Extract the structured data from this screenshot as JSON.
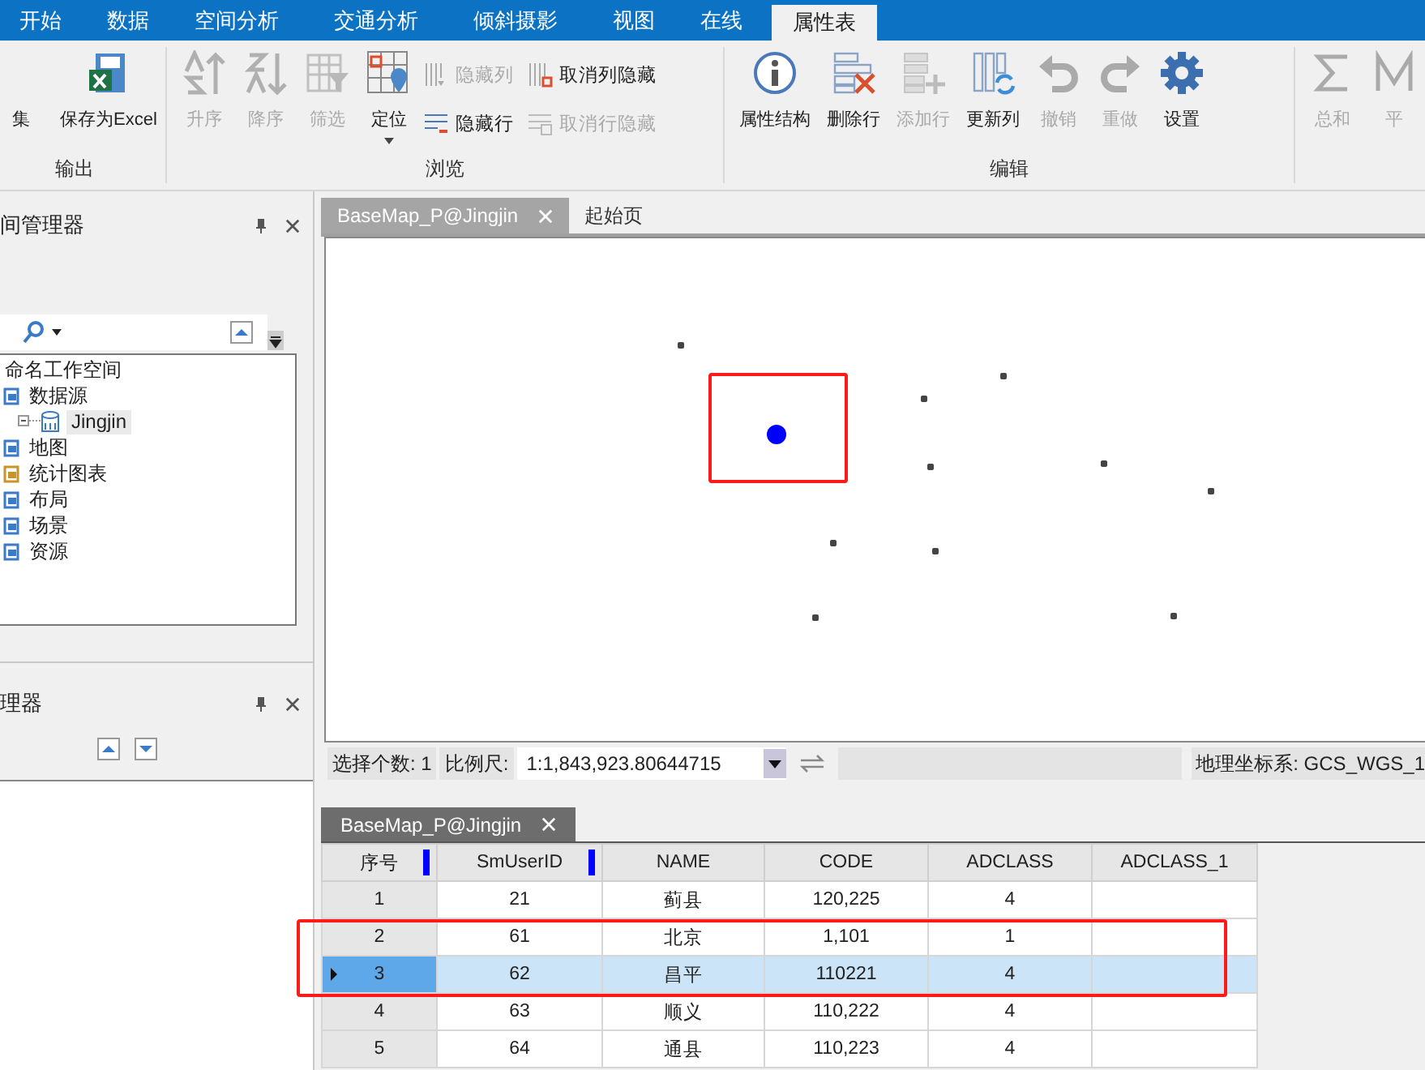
{
  "ribbon_tabs": [
    {
      "label": "开始",
      "selected": false
    },
    {
      "label": "数据",
      "selected": false
    },
    {
      "label": "空间分析",
      "selected": false
    },
    {
      "label": "交通分析",
      "selected": false
    },
    {
      "label": "倾斜摄影",
      "selected": false
    },
    {
      "label": "视图",
      "selected": false
    },
    {
      "label": "在线",
      "selected": false
    },
    {
      "label": "属性表",
      "selected": true
    }
  ],
  "ribbon_groups": [
    {
      "label": "输出",
      "buttons": [
        {
          "label": "集",
          "kind": "none",
          "disabled": false,
          "dropdown": false
        },
        {
          "label": "保存为Excel",
          "kind": "excel",
          "disabled": false,
          "dropdown": false
        }
      ]
    },
    {
      "label": "浏览",
      "buttons": [
        {
          "label": "升序",
          "kind": "sort-asc",
          "disabled": true,
          "dropdown": false
        },
        {
          "label": "降序",
          "kind": "sort-desc",
          "disabled": true,
          "dropdown": false
        },
        {
          "label": "筛选",
          "kind": "filter",
          "disabled": true,
          "dropdown": false
        },
        {
          "label": "定位",
          "kind": "locate",
          "disabled": false,
          "dropdown": true
        }
      ],
      "small_buttons": [
        {
          "label": "隐藏列",
          "kind": "hide-col",
          "disabled": true
        },
        {
          "label": "隐藏行",
          "kind": "hide-row",
          "disabled": false
        },
        {
          "label": "取消列隐藏",
          "kind": "show-col",
          "disabled": false
        },
        {
          "label": "取消行隐藏",
          "kind": "show-row",
          "disabled": true
        }
      ]
    },
    {
      "label": "编辑",
      "buttons": [
        {
          "label": "属性结构",
          "kind": "info",
          "disabled": false,
          "dropdown": false
        },
        {
          "label": "删除行",
          "kind": "delete-row",
          "disabled": false,
          "dropdown": false
        },
        {
          "label": "添加行",
          "kind": "add-row",
          "disabled": true,
          "dropdown": false
        },
        {
          "label": "更新列",
          "kind": "refresh-col",
          "disabled": false,
          "dropdown": false
        },
        {
          "label": "撤销",
          "kind": "undo",
          "disabled": true,
          "dropdown": false
        },
        {
          "label": "重做",
          "kind": "redo",
          "disabled": true,
          "dropdown": false
        },
        {
          "label": "设置",
          "kind": "gear",
          "disabled": false,
          "dropdown": false
        }
      ]
    },
    {
      "buttons": [
        {
          "label": "总和",
          "kind": "sum",
          "disabled": true,
          "dropdown": false
        },
        {
          "label": "平",
          "kind": "mean",
          "disabled": true,
          "dropdown": false
        }
      ]
    }
  ],
  "workspace_panel": {
    "title": "间管理器",
    "tree": [
      {
        "label": "命名工作空间",
        "selected": false,
        "children": [
          {
            "label": "数据源",
            "kind": "datasources",
            "selected": false,
            "children": [
              {
                "label": "Jingjin",
                "kind": "datasource",
                "selected": true
              }
            ]
          },
          {
            "label": "地图",
            "kind": "map",
            "selected": false
          },
          {
            "label": "统计图表",
            "kind": "chart",
            "selected": false
          },
          {
            "label": "布局",
            "kind": "layout",
            "selected": false
          },
          {
            "label": "场景",
            "kind": "scene",
            "selected": false
          },
          {
            "label": "资源",
            "kind": "resource",
            "selected": false
          }
        ]
      }
    ]
  },
  "layer_panel": {
    "title": "理器"
  },
  "map_tabs": [
    {
      "label": "BaseMap_P@Jingjin",
      "selected": true,
      "closable": true
    },
    {
      "label": "起始页",
      "selected": false,
      "closable": false
    }
  ],
  "status_bar": {
    "selection_count": "选择个数: 1",
    "scale_label": "比例尺:",
    "scale_value": "1:1,843,923.80644715",
    "coordinate_system": "地理坐标系: GCS_WGS_1"
  },
  "table_tab": {
    "label": "BaseMap_P@Jingjin"
  },
  "table": {
    "columns": [
      {
        "label": "序号",
        "marked": true
      },
      {
        "label": "SmUserID",
        "marked": true
      },
      {
        "label": "NAME",
        "marked": false
      },
      {
        "label": "CODE",
        "marked": false
      },
      {
        "label": "ADCLASS",
        "marked": false
      },
      {
        "label": "ADCLASS_1",
        "marked": false
      }
    ],
    "rows": [
      {
        "selected": false,
        "cells": [
          "1",
          "21",
          "蓟县",
          "120,225",
          "4",
          ""
        ]
      },
      {
        "selected": false,
        "cells": [
          "2",
          "61",
          "北京",
          "1,101",
          "1",
          ""
        ]
      },
      {
        "selected": true,
        "cells": [
          "3",
          "62",
          "昌平",
          "110221",
          "4",
          ""
        ]
      },
      {
        "selected": false,
        "cells": [
          "4",
          "63",
          "顺义",
          "110,222",
          "4",
          ""
        ]
      },
      {
        "selected": false,
        "cells": [
          "5",
          "64",
          "通县",
          "110,223",
          "4",
          ""
        ]
      }
    ]
  }
}
